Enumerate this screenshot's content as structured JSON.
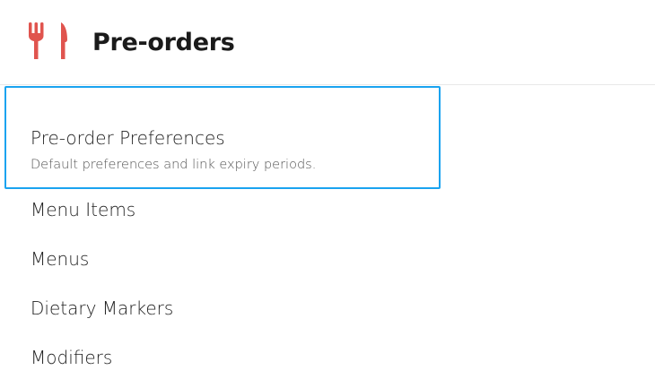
{
  "header": {
    "title": "Pre-orders",
    "icon": "fork-knife-icon",
    "icon_color": "#e0544e"
  },
  "selection_color": "#1aa3f0",
  "nav": {
    "selected": {
      "label": "Pre-order Preferences",
      "description": "Default preferences and link expiry periods."
    },
    "items": [
      {
        "label": "Menu Items"
      },
      {
        "label": "Menus"
      },
      {
        "label": "Dietary Markers"
      },
      {
        "label": "Modifiers"
      }
    ]
  }
}
